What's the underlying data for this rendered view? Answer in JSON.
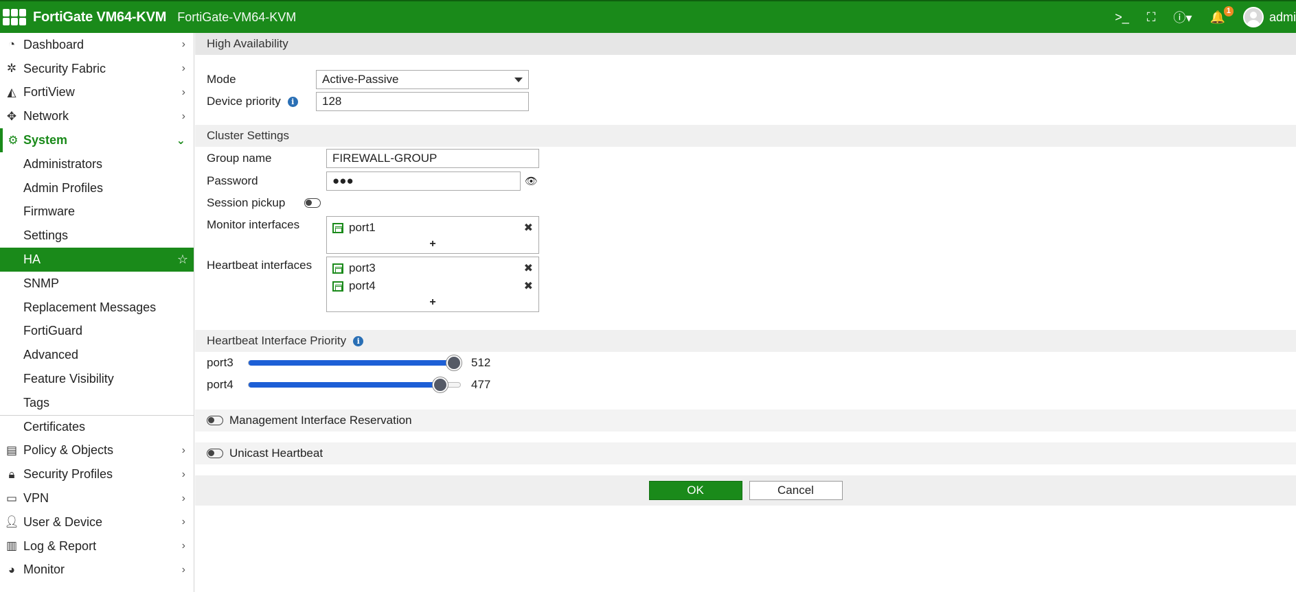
{
  "header": {
    "brand": "FortiGate VM64-KVM",
    "hostname": "FortiGate-VM64-KVM",
    "notification_count": "1",
    "user": "admi"
  },
  "sidebar": {
    "items": [
      {
        "label": "Dashboard",
        "icon": "dashboard-icon"
      },
      {
        "label": "Security Fabric",
        "icon": "fabric-icon"
      },
      {
        "label": "FortiView",
        "icon": "chart-icon"
      },
      {
        "label": "Network",
        "icon": "move-icon"
      },
      {
        "label": "System",
        "icon": "gear-icon"
      }
    ],
    "system_sub": [
      "Administrators",
      "Admin Profiles",
      "Firmware",
      "Settings",
      "HA",
      "SNMP",
      "Replacement Messages",
      "FortiGuard",
      "Advanced",
      "Feature Visibility",
      "Tags",
      "Certificates"
    ],
    "items_after": [
      {
        "label": "Policy & Objects",
        "icon": "policy-icon"
      },
      {
        "label": "Security Profiles",
        "icon": "lock-icon"
      },
      {
        "label": "VPN",
        "icon": "laptop-icon"
      },
      {
        "label": "User & Device",
        "icon": "user-icon"
      },
      {
        "label": "Log & Report",
        "icon": "bar-chart-icon"
      },
      {
        "label": "Monitor",
        "icon": "pie-icon"
      }
    ]
  },
  "ha": {
    "title": "High Availability",
    "mode_label": "Mode",
    "mode_value": "Active-Passive",
    "priority_label": "Device priority",
    "priority_value": "128"
  },
  "cluster": {
    "title": "Cluster Settings",
    "group_label": "Group name",
    "group_value": "FIREWALL-GROUP",
    "password_label": "Password",
    "password_value": "●●●",
    "session_label": "Session pickup",
    "monitor_label": "Monitor interfaces",
    "monitor_interfaces": [
      "port1"
    ],
    "heartbeat_label": "Heartbeat interfaces",
    "heartbeat_interfaces": [
      "port3",
      "port4"
    ],
    "add": "+"
  },
  "hb_priority": {
    "title": "Heartbeat Interface Priority",
    "ports": [
      {
        "name": "port3",
        "value": "512",
        "fraction": 1.0
      },
      {
        "name": "port4",
        "value": "477",
        "fraction": 0.93
      }
    ]
  },
  "options": {
    "mgmt_label": "Management Interface Reservation",
    "unicast_label": "Unicast Heartbeat"
  },
  "buttons": {
    "ok": "OK",
    "cancel": "Cancel"
  },
  "colors": {
    "accent": "#1a8a1a",
    "slider": "#1d5fd6",
    "badge": "#f08a24"
  }
}
